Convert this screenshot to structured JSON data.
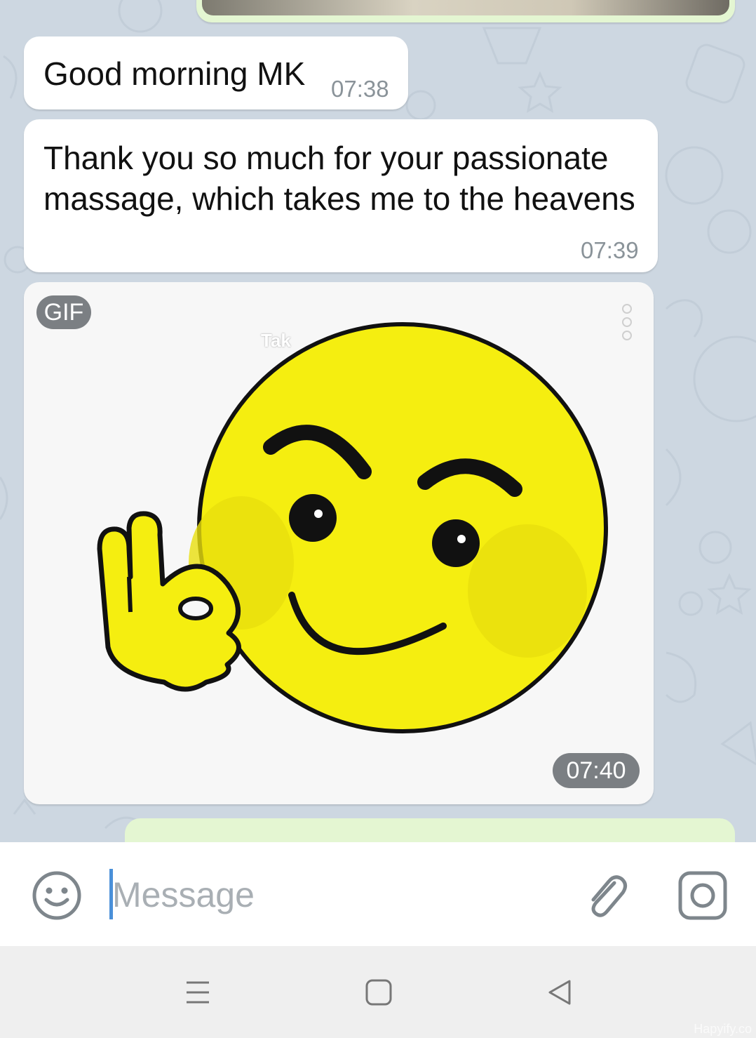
{
  "messages": [
    {
      "text": "Good morning MK",
      "time": "07:38"
    },
    {
      "text": "Thank you so much for your passionate massage, which takes me to the heavens",
      "time": "07:39"
    }
  ],
  "gif_message": {
    "badge": "GIF",
    "time": "07:40",
    "overlay_text": "Tak"
  },
  "composer": {
    "placeholder": "Message",
    "left_icon": "smile-icon",
    "attach_icon": "paperclip-icon",
    "camera_icon": "camera-icon"
  },
  "navigation": {
    "icons": [
      "recent-apps-icon",
      "home-icon",
      "back-icon"
    ]
  },
  "watermark": "Hapyify.co",
  "colors": {
    "incoming_bubble": "#ffffff",
    "outgoing_bubble": "#e4f6d2",
    "chat_background": "#cdd7e1",
    "emoji_yellow": "#f5ee10",
    "caret": "#4a90d9"
  }
}
